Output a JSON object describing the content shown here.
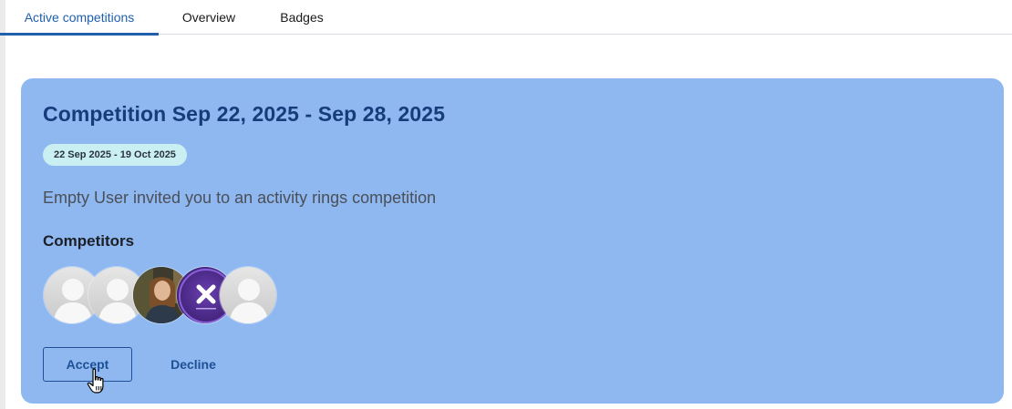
{
  "tabs": [
    {
      "label": "Active competitions",
      "active": true
    },
    {
      "label": "Overview",
      "active": false
    },
    {
      "label": "Badges",
      "active": false
    }
  ],
  "card": {
    "title": "Competition Sep 22, 2025 - Sep 28, 2025",
    "date_range": "22 Sep 2025 - 19 Oct 2025",
    "invite_text": "Empty User invited you to an activity rings competition",
    "competitors_label": "Competitors",
    "competitors": [
      {
        "avatar": "default-user-avatar"
      },
      {
        "avatar": "default-user-avatar"
      },
      {
        "avatar": "photo-user-avatar"
      },
      {
        "avatar": "brand-x-logo-avatar"
      },
      {
        "avatar": "default-user-avatar"
      }
    ],
    "accept_label": "Accept",
    "decline_label": "Decline"
  },
  "colors": {
    "accent": "#1f5fae",
    "card_bg": "#8fb8f0",
    "badge_bg": "#c9eff2",
    "title": "#163d7a"
  }
}
